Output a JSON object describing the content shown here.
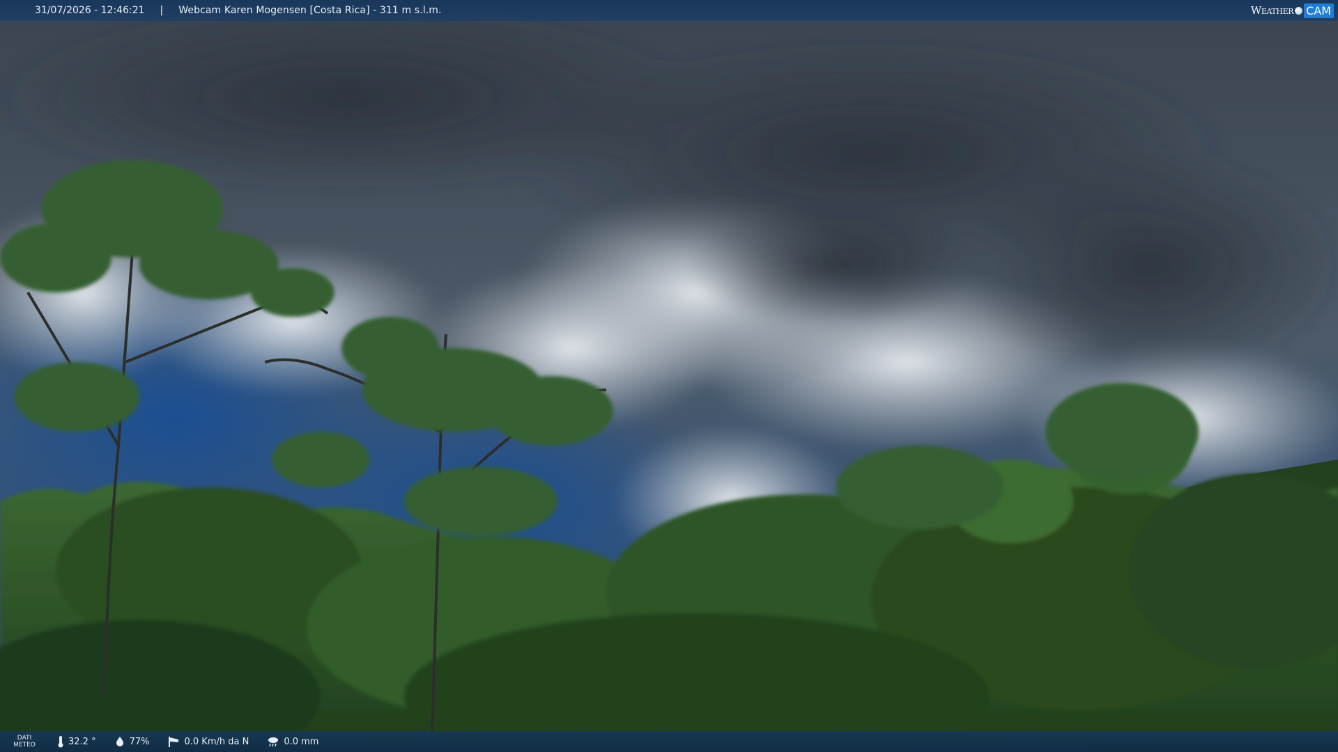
{
  "header": {
    "datetime": "31/07/2026 - 12:46:21",
    "separator": "|",
    "title": "Webcam Karen Mogensen [Costa Rica]  - 311 m s.l.m.",
    "logo": {
      "word": "Weather",
      "cam": "CAM"
    }
  },
  "footer": {
    "dati_line1": "DATI",
    "dati_line2": "METEO",
    "temperature": "32.2 °",
    "humidity": "77%",
    "wind": "0.0 Km/h da N",
    "rain": "0.0 mm"
  },
  "scene": {
    "icons": {
      "temperature": "thermometer-icon",
      "humidity": "humidity-drop-icon",
      "wind": "wind-sock-icon",
      "rain": "rain-cloud-icon"
    },
    "colors": {
      "bar": "#1c3a60",
      "sky_blue": "#1f4f8a",
      "cloud_dark": "#3a434f",
      "cloud_light": "#d8dde3",
      "foliage": "#2f5a27"
    }
  }
}
